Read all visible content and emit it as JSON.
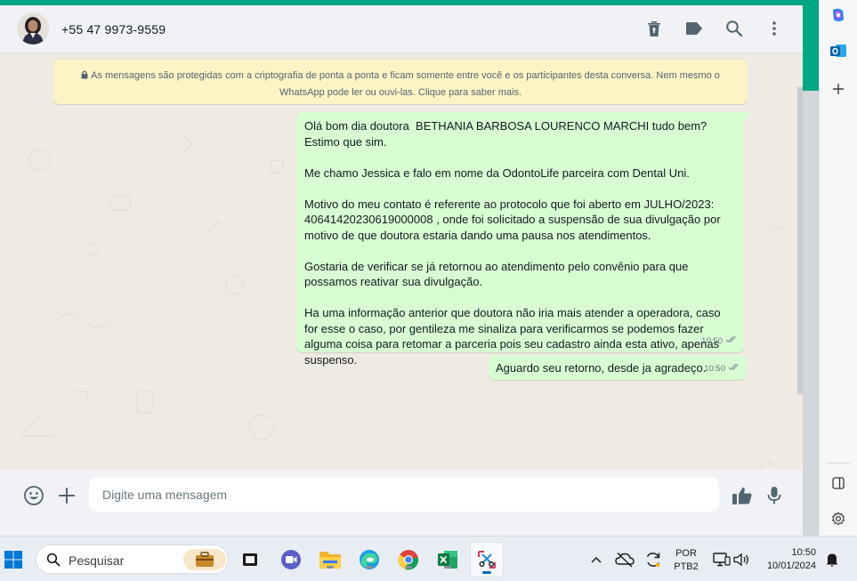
{
  "chat": {
    "contact_name": "+55 47 9973-9559",
    "encryption_notice_line1": "As mensagens são protegidas com a criptografia de ponta a ponta e ficam somente entre você e os participantes desta conversa. Nem mesmo o",
    "encryption_notice_line2": "WhatsApp pode ler ou ouvi-las. Clique para saber mais.",
    "messages": [
      {
        "text": "Olá bom dia doutora  BETHANIA BARBOSA LOURENCO MARCHI tudo bem? Estimo que sim.\n\nMe chamo Jessica e falo em nome da OdontoLife parceira com Dental Uni.\n\nMotivo do meu contato é referente ao protocolo que foi aberto em JULHO/2023: 40641420230619000008 , onde foi solicitado a suspensão de sua divulgação por motivo de que doutora estaria dando uma pausa nos atendimentos.\n\nGostaria de verificar se já retornou ao atendimento pelo convênio para que possamos reativar sua divulgação.\n\nHa uma informação anterior que doutora não iria mais atender a operadora, caso for esse o caso, por gentileza me sinaliza para verificarmos se podemos fazer alguma coisa para retomar a parceria pois seu cadastro ainda esta ativo, apenas suspenso.",
        "time": "10:50"
      },
      {
        "text": "Aguardo seu retorno, desde ja agradeço.",
        "time": "10:50"
      }
    ]
  },
  "composer": {
    "placeholder": "Digite uma mensagem"
  },
  "taskbar": {
    "search_label": "Pesquisar",
    "language_line1": "POR",
    "language_line2": "PTB2",
    "time": "10:50",
    "date": "10/01/2024"
  },
  "colors": {
    "accent": "#00a884",
    "outgoing_bubble": "#d9fdd3",
    "encryption_banner": "#fdf4c5",
    "chat_background": "#efeae2"
  }
}
